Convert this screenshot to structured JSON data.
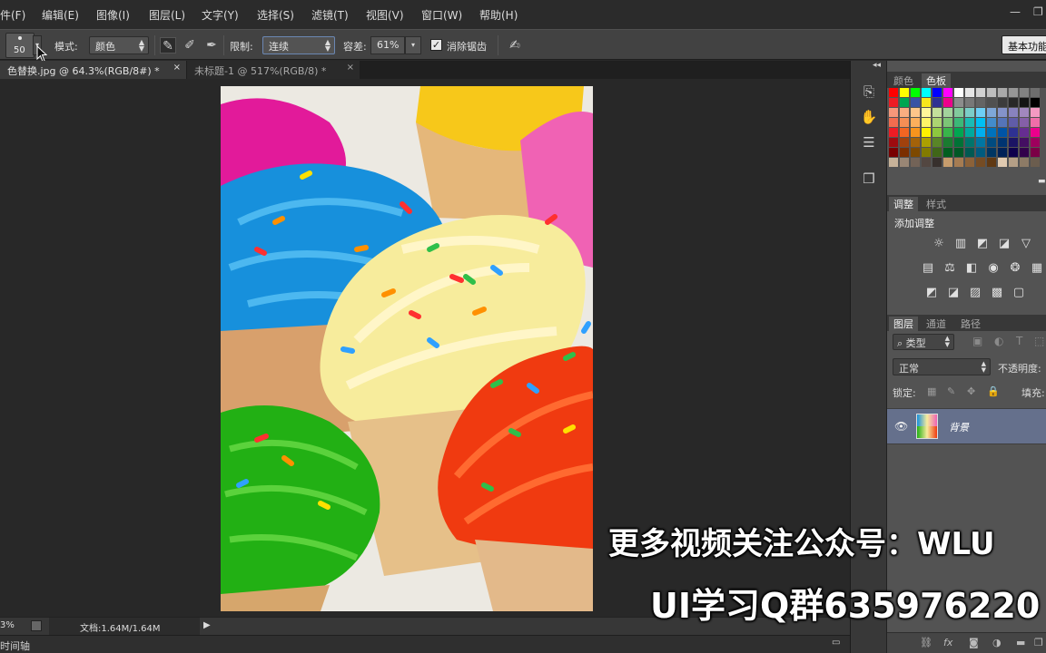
{
  "menubar": {
    "items": [
      "件(F)",
      "编辑(E)",
      "图像(I)",
      "图层(L)",
      "文字(Y)",
      "选择(S)",
      "滤镜(T)",
      "视图(V)",
      "窗口(W)",
      "帮助(H)"
    ],
    "window_controls": {
      "minimize": "—",
      "restore": "❐"
    }
  },
  "options": {
    "brush_size": "50",
    "mode_label": "模式:",
    "mode_value": "颜色",
    "limit_label": "限制:",
    "limit_value": "连续",
    "tolerance_label": "容差:",
    "tolerance_value": "61%",
    "antialias_label": "消除锯齿",
    "antialias_checked": true,
    "workspace_button": "基本功能"
  },
  "tabs": [
    {
      "label": "色替换.jpg @ 64.3%(RGB/8#) *",
      "close": "×"
    },
    {
      "label": "未标题-1 @ 517%(RGB/8) *",
      "close": "×"
    }
  ],
  "status": {
    "zoom": "3%",
    "doc_info": "文档:1.64M/1.64M",
    "timeline": "时间轴"
  },
  "panels": {
    "swatches_tabs": [
      "颜色",
      "色板"
    ],
    "adjust_tabs": [
      "调整",
      "样式"
    ],
    "add_adjustment": "添加调整",
    "layers_tabs": [
      "图层",
      "通道",
      "路径"
    ],
    "filter_kind": "类型",
    "blend_mode": "正常",
    "opacity_label": "不透明度:",
    "lock_label": "锁定:",
    "fill_label": "填充:",
    "layer_name": "背景"
  },
  "swatch_colors": [
    [
      "#ff0000",
      "#ffff00",
      "#00ff00",
      "#00ffff",
      "#0000ff",
      "#ff00ff",
      "#ffffff",
      "#e6e6e6",
      "#d2d2d2",
      "#bebebe",
      "#aaaaaa",
      "#969696",
      "#828282",
      "#6e6e6e"
    ],
    [
      "#ec1c24",
      "#00a651",
      "#3953a4",
      "#f8e71c",
      "#2e3192",
      "#ed008c",
      "#8c8c8c",
      "#787878",
      "#646464",
      "#505050",
      "#3c3c3c",
      "#282828",
      "#141414",
      "#000000"
    ],
    [
      "#f7977a",
      "#f9ad81",
      "#fdc68a",
      "#fff79a",
      "#c4df9b",
      "#a3d39c",
      "#82ca9d",
      "#7bcdc8",
      "#6ecff6",
      "#7ea7d8",
      "#8493ca",
      "#8882be",
      "#a187be",
      "#f49ac2"
    ],
    [
      "#f26c4f",
      "#f68e55",
      "#fbaf5c",
      "#fff467",
      "#acd372",
      "#7cc576",
      "#3bb878",
      "#1abbb4",
      "#00bff3",
      "#438ccb",
      "#5574b9",
      "#605ca8",
      "#855fa8",
      "#f06ea9"
    ],
    [
      "#ed1c24",
      "#f26522",
      "#f7941d",
      "#fff200",
      "#8dc73f",
      "#39b54a",
      "#00a651",
      "#00a99d",
      "#00aeef",
      "#0072bc",
      "#0054a6",
      "#2e3192",
      "#662d91",
      "#ec008c"
    ],
    [
      "#9e0b0f",
      "#a0410d",
      "#a36209",
      "#aba000",
      "#598527",
      "#1a7b30",
      "#007236",
      "#00746b",
      "#0076a3",
      "#004b80",
      "#003471",
      "#1b1464",
      "#440e62",
      "#9e005d"
    ],
    [
      "#790000",
      "#7b2e00",
      "#7d4900",
      "#827b00",
      "#406618",
      "#005e20",
      "#005826",
      "#005952",
      "#005b7f",
      "#003663",
      "#002157",
      "#0d004c",
      "#32004b",
      "#7b0046"
    ],
    [
      "#c7b299",
      "#998675",
      "#736357",
      "#534741",
      "#37302d",
      "#c69c6d",
      "#a67c52",
      "#8c6239",
      "#754c24",
      "#603913",
      "#e0cab0",
      "#b49f86",
      "#8d7b66",
      "#6b5d4e"
    ]
  ],
  "adjust_icons": [
    [
      "brightness-icon",
      "levels-icon",
      "curves-icon",
      "exposure-icon",
      "vibrance-icon"
    ],
    [
      "hue-sat-icon",
      "color-balance-icon",
      "black-white-icon",
      "photo-filter-icon",
      "channel-mixer-icon",
      "color-lookup-icon"
    ],
    [
      "invert-icon",
      "posterize-icon",
      "threshold-icon",
      "gradient-map-icon",
      "selective-color-icon"
    ]
  ],
  "overlay": {
    "line1": "更多视频关注公众号：WLU",
    "line2": "UI学习Q群635976220"
  }
}
